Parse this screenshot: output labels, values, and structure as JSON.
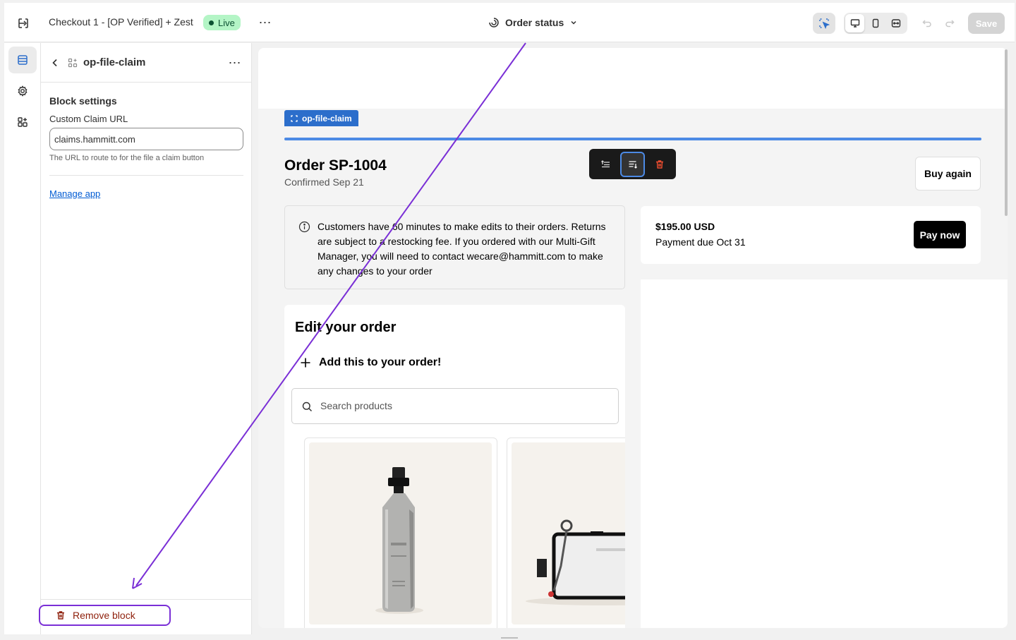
{
  "topbar": {
    "title": "Checkout 1 - [OP Verified] + Zest",
    "status_badge": "Live",
    "page_selector": "Order status",
    "save_label": "Save",
    "icons": [
      "exit-icon",
      "more-icon",
      "order-status-icon",
      "chevron-down-icon",
      "inspector-icon",
      "desktop-icon",
      "mobile-icon",
      "fullwidth-icon",
      "undo-icon",
      "redo-icon"
    ]
  },
  "panel": {
    "title": "op-file-claim",
    "section_title": "Block settings",
    "field_label": "Custom Claim URL",
    "field_value": "claims.hammitt.com",
    "help_text": "The URL to route to for the file a claim button",
    "manage_link": "Manage app",
    "remove_label": "Remove block"
  },
  "preview": {
    "block_tag": "op-file-claim",
    "order_title": "Order SP-1004",
    "order_subtitle": "Confirmed Sep 21",
    "buy_again": "Buy again",
    "notice": "Customers have 60 minutes to make edits to their orders. Returns are subject to a restocking fee. If you ordered with our Multi-Gift Manager, you will need to contact wecare@hammitt.com to make any changes to your order",
    "amount": "$195.00 USD",
    "payment_due": "Payment due Oct 31",
    "pay_now": "Pay now",
    "edit_title": "Edit your order",
    "add_label": "Add this to your order!",
    "search_placeholder": "Search products"
  },
  "colors": {
    "live_bg": "#b4f5c6",
    "accent_blue": "#2c6ecb",
    "arrow_purple": "#7a2fd6",
    "remove_text": "#8e1f0b"
  }
}
